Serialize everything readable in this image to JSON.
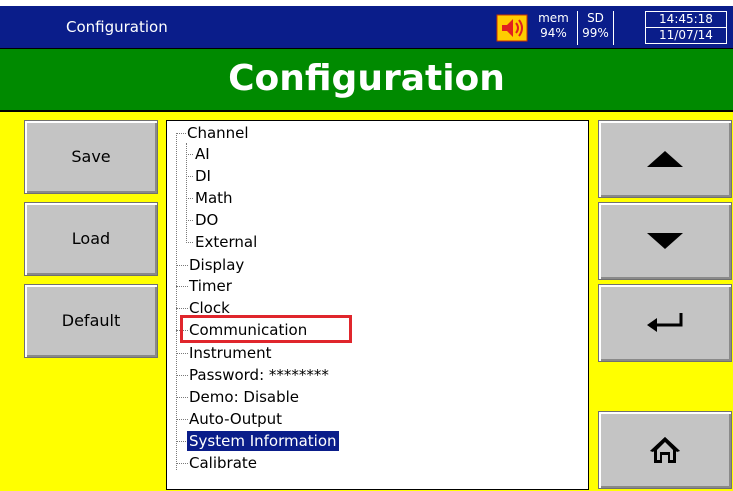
{
  "titlebar": {
    "title": "Configuration",
    "mem_label": "mem",
    "mem_value": "94%",
    "sd_label": "SD",
    "sd_value": "99%",
    "time": "14:45:18",
    "date": "11/07/14"
  },
  "header": {
    "title": "Configuration"
  },
  "left_buttons": {
    "save": "Save",
    "load": "Load",
    "default": "Default"
  },
  "tree": {
    "items": [
      "Channel",
      "AI",
      "DI",
      "Math",
      "DO",
      "External",
      "Display",
      "Timer",
      "Clock",
      "Communication",
      "Instrument",
      "Password: ********",
      "Demo: Disable",
      "Auto-Output",
      "System Information",
      "Calibrate"
    ],
    "selected": "System Information",
    "highlighted": "Communication"
  },
  "right_buttons": {
    "up_icon": "arrow-up-icon",
    "down_icon": "arrow-down-icon",
    "enter_icon": "enter-icon",
    "home_icon": "home-icon"
  },
  "colors": {
    "background": "#ffff00",
    "titlebar": "#0a1d8a",
    "header": "#008a00",
    "button": "#c4c4c4",
    "highlight": "#e0262c",
    "selected": "#0a1d8a"
  }
}
